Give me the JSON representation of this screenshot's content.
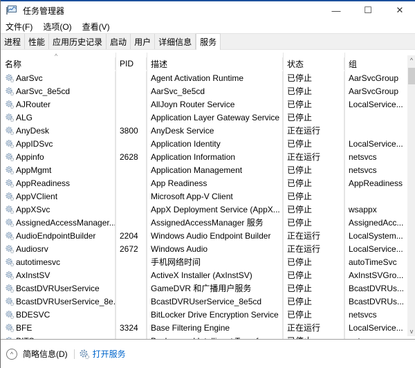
{
  "window": {
    "title": "任务管理器",
    "controls": {
      "minimize": "—",
      "maximize": "☐",
      "close": "✕"
    },
    "accent_color": "#1b4f9c"
  },
  "menu": [
    {
      "label": "文件(F)"
    },
    {
      "label": "选项(O)"
    },
    {
      "label": "查看(V)"
    }
  ],
  "tabs": [
    {
      "label": "进程",
      "active": false
    },
    {
      "label": "性能",
      "active": false
    },
    {
      "label": "应用历史记录",
      "active": false
    },
    {
      "label": "启动",
      "active": false
    },
    {
      "label": "用户",
      "active": false
    },
    {
      "label": "详细信息",
      "active": false
    },
    {
      "label": "服务",
      "active": true
    }
  ],
  "table": {
    "sort_indicator": "^",
    "columns": [
      "名称",
      "PID",
      "描述",
      "状态",
      "组"
    ],
    "rows": [
      {
        "name": "AarSvc",
        "pid": "",
        "desc": "Agent Activation Runtime",
        "status": "已停止",
        "group": "AarSvcGroup"
      },
      {
        "name": "AarSvc_8e5cd",
        "pid": "",
        "desc": "AarSvc_8e5cd",
        "status": "已停止",
        "group": "AarSvcGroup"
      },
      {
        "name": "AJRouter",
        "pid": "",
        "desc": "AllJoyn Router Service",
        "status": "已停止",
        "group": "LocalService..."
      },
      {
        "name": "ALG",
        "pid": "",
        "desc": "Application Layer Gateway Service",
        "status": "已停止",
        "group": ""
      },
      {
        "name": "AnyDesk",
        "pid": "3800",
        "desc": "AnyDesk Service",
        "status": "正在运行",
        "group": ""
      },
      {
        "name": "AppIDSvc",
        "pid": "",
        "desc": "Application Identity",
        "status": "已停止",
        "group": "LocalService..."
      },
      {
        "name": "Appinfo",
        "pid": "2628",
        "desc": "Application Information",
        "status": "正在运行",
        "group": "netsvcs"
      },
      {
        "name": "AppMgmt",
        "pid": "",
        "desc": "Application Management",
        "status": "已停止",
        "group": "netsvcs"
      },
      {
        "name": "AppReadiness",
        "pid": "",
        "desc": "App Readiness",
        "status": "已停止",
        "group": "AppReadiness"
      },
      {
        "name": "AppVClient",
        "pid": "",
        "desc": "Microsoft App-V Client",
        "status": "已停止",
        "group": ""
      },
      {
        "name": "AppXSvc",
        "pid": "",
        "desc": "AppX Deployment Service (AppX...",
        "status": "已停止",
        "group": "wsappx"
      },
      {
        "name": "AssignedAccessManager...",
        "pid": "",
        "desc": "AssignedAccessManager 服务",
        "status": "已停止",
        "group": "AssignedAcc..."
      },
      {
        "name": "AudioEndpointBuilder",
        "pid": "2204",
        "desc": "Windows Audio Endpoint Builder",
        "status": "正在运行",
        "group": "LocalSystem..."
      },
      {
        "name": "Audiosrv",
        "pid": "2672",
        "desc": "Windows Audio",
        "status": "正在运行",
        "group": "LocalService..."
      },
      {
        "name": "autotimesvc",
        "pid": "",
        "desc": "手机网络时间",
        "status": "已停止",
        "group": "autoTimeSvc"
      },
      {
        "name": "AxInstSV",
        "pid": "",
        "desc": "ActiveX Installer (AxInstSV)",
        "status": "已停止",
        "group": "AxInstSVGro..."
      },
      {
        "name": "BcastDVRUserService",
        "pid": "",
        "desc": "GameDVR 和广播用户服务",
        "status": "已停止",
        "group": "BcastDVRUs..."
      },
      {
        "name": "BcastDVRUserService_8e...",
        "pid": "",
        "desc": "BcastDVRUserService_8e5cd",
        "status": "已停止",
        "group": "BcastDVRUs..."
      },
      {
        "name": "BDESVC",
        "pid": "",
        "desc": "BitLocker Drive Encryption Service",
        "status": "已停止",
        "group": "netsvcs"
      },
      {
        "name": "BFE",
        "pid": "3324",
        "desc": "Base Filtering Engine",
        "status": "正在运行",
        "group": "LocalService..."
      },
      {
        "name": "BITS",
        "pid": "",
        "desc": "Background Intelligent Transfer...",
        "status": "已停止",
        "group": "netsvcs"
      }
    ]
  },
  "scrollbar": {
    "up": "^",
    "down": "v"
  },
  "footer": {
    "collapse_icon": "^",
    "summary_label": "简略信息(D)",
    "open_services_label": "打开服务",
    "link_color": "#0066cc"
  }
}
